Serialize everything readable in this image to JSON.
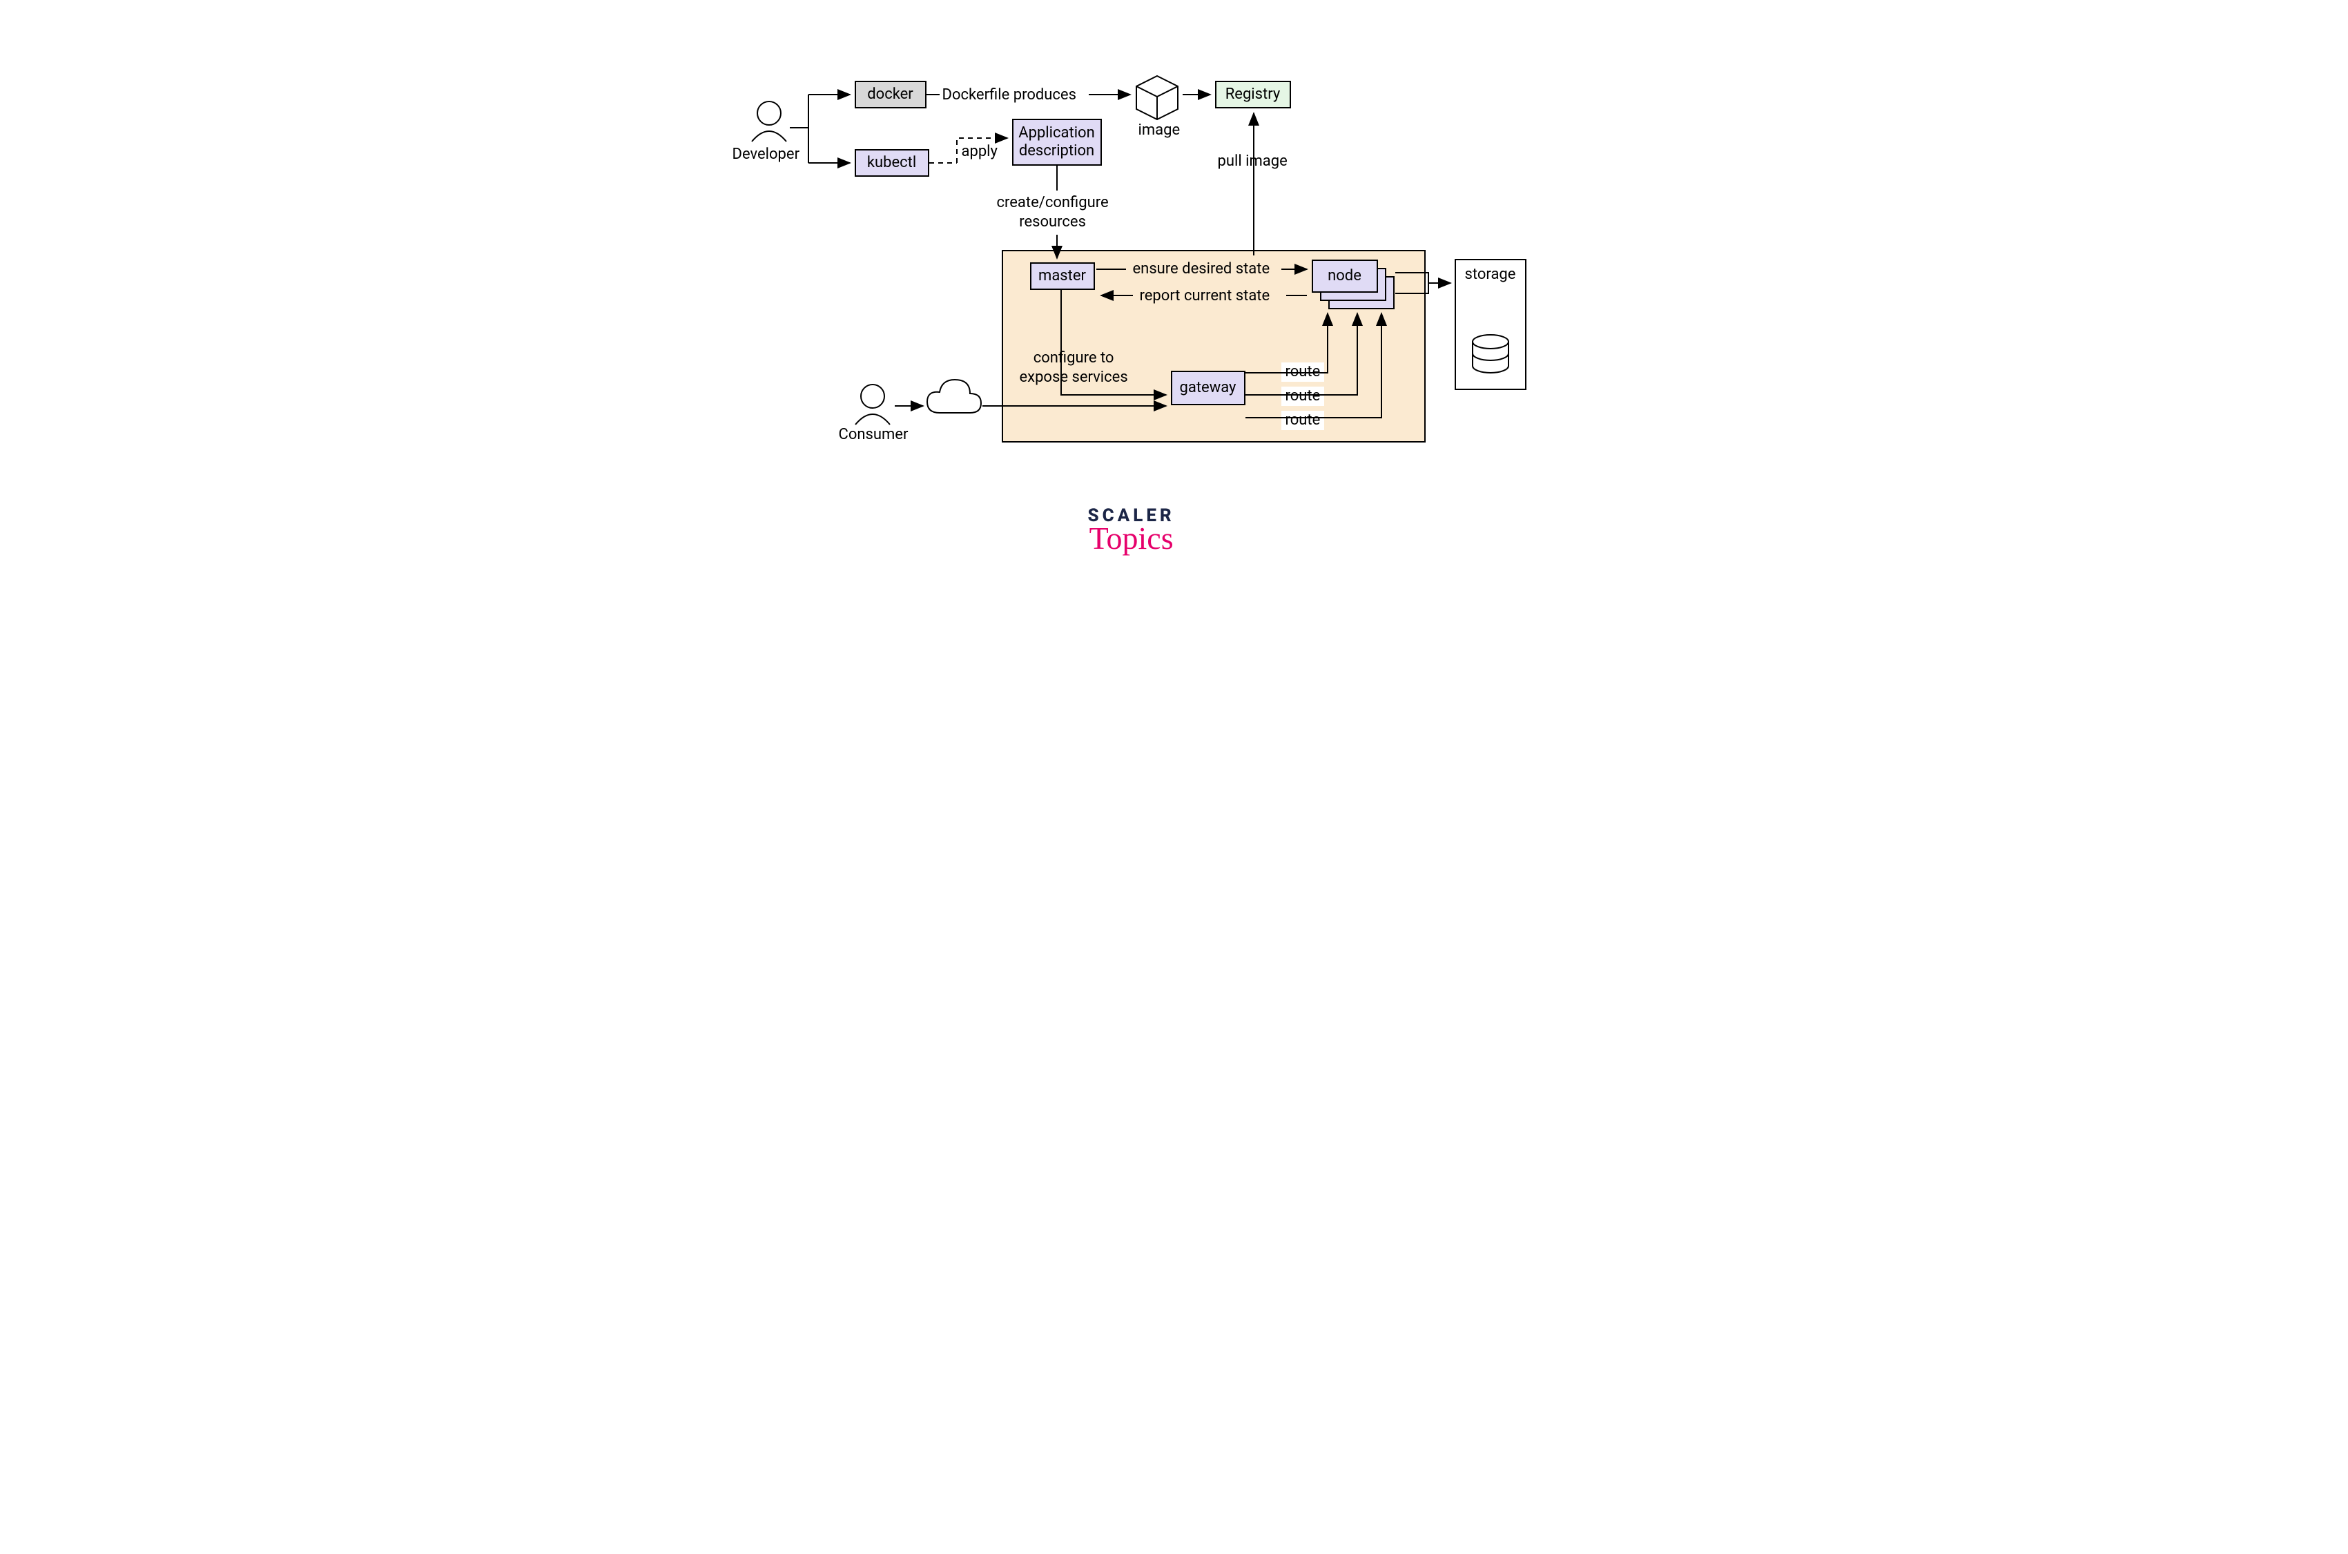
{
  "actors": {
    "developer": "Developer",
    "consumer": "Consumer"
  },
  "boxes": {
    "docker": "docker",
    "kubectl": "kubectl",
    "app_desc": "Application\ndescription",
    "registry": "Registry",
    "master": "master",
    "gateway": "gateway",
    "node": "node",
    "storage": "storage"
  },
  "edges": {
    "dockerfile_produces": "Dockerfile produces",
    "image": "image",
    "pull_image": "pull image",
    "apply": "apply",
    "create_configure": "create/configure\nresources",
    "ensure_desired": "ensure desired state",
    "report_current": "report current state",
    "configure_expose": "configure to\nexpose services",
    "route1": "route",
    "route2": "route",
    "route3": "route"
  },
  "branding": {
    "line1": "SCALER",
    "line2": "Topics"
  }
}
